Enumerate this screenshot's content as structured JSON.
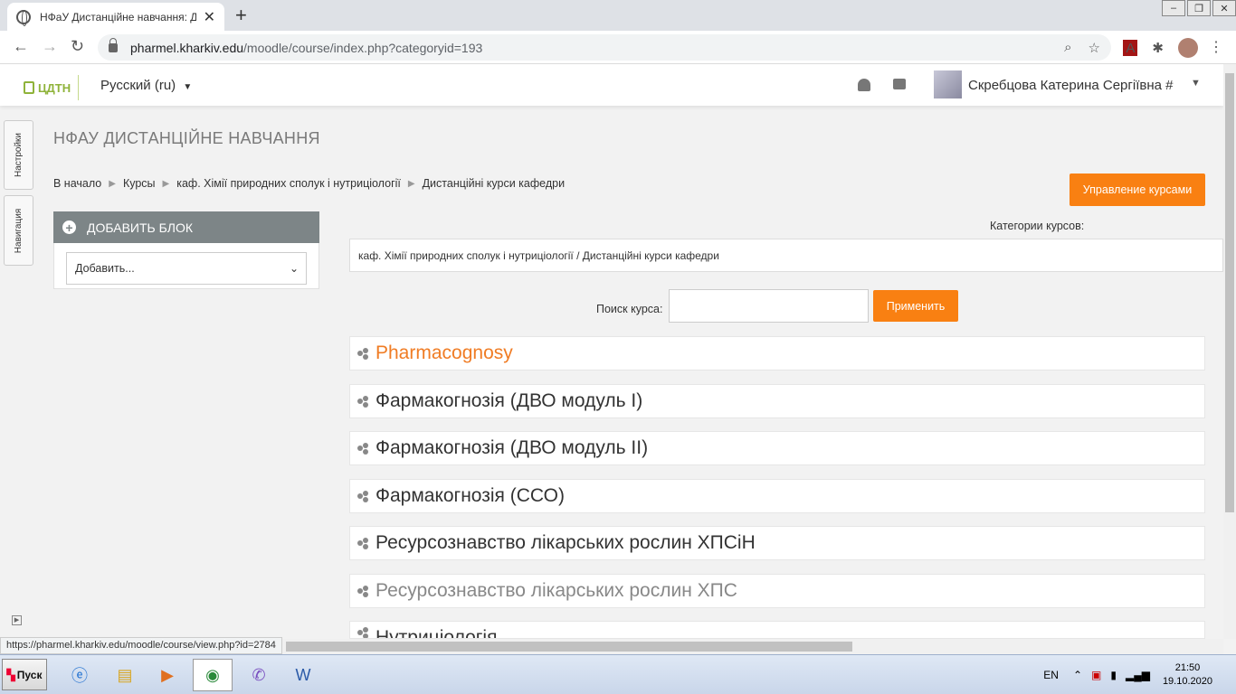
{
  "browser": {
    "tab_title": "НФаУ Дистанційне навчання: Дист",
    "url_host": "pharmel.kharkiv.edu",
    "url_path": "/moodle/course/index.php?categoryid=193",
    "status_url": "https://pharmel.kharkiv.edu/moodle/course/view.php?id=2784"
  },
  "navbar": {
    "logo_text": "ЦДТН",
    "language": "Русский (ru)",
    "user_name": "Скребцова Катерина Сергіївна #"
  },
  "side_tabs": {
    "settings": "Настройки",
    "navigation": "Навигация"
  },
  "page": {
    "title": "НФАУ ДИСТАНЦІЙНЕ НАВЧАННЯ",
    "breadcrumb": [
      "В начало",
      "Курсы",
      "каф. Хімії природних сполук і нутриціології",
      "Дистанційні курси кафедри"
    ],
    "manage_label": "Управление курсами"
  },
  "block": {
    "title": "ДОБАВИТЬ БЛОК",
    "select_value": "Добавить..."
  },
  "categories": {
    "label": "Категории курсов:",
    "selected": "каф. Хімії природних сполук і нутриціології / Дистанційні курси кафедри"
  },
  "search": {
    "label": "Поиск курса:",
    "button": "Применить"
  },
  "courses": [
    {
      "name": "Pharmacognosy"
    },
    {
      "name": "Фармакогнозія (ДВО модуль I)"
    },
    {
      "name": "Фармакогнозія (ДВО модуль II)"
    },
    {
      "name": "Фармакогнозія (ССО)"
    },
    {
      "name": "Ресурсознавство лікарських рослин ХПСіН"
    },
    {
      "name": "Ресурсознавство лікарських рослин ХПС"
    },
    {
      "name": "Нутриціологія"
    }
  ],
  "taskbar": {
    "start": "Пуск",
    "lang": "EN",
    "time": "21:50",
    "date": "19.10.2020"
  },
  "colors": {
    "accent": "#f98012",
    "block_header": "#7d8587"
  }
}
